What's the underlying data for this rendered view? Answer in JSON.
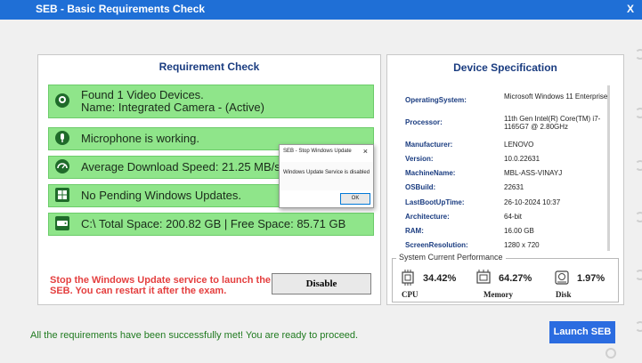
{
  "window": {
    "title": "SEB - Basic Requirements Check",
    "close_label": "X"
  },
  "requirement_check": {
    "title": "Requirement Check",
    "items": [
      {
        "icon": "camera-icon",
        "line1": "Found 1 Video Devices.",
        "line2": "Name:  Integrated Camera - (Active)"
      },
      {
        "icon": "microphone-icon",
        "line1": "Microphone is working."
      },
      {
        "icon": "speedometer-icon",
        "line1": "Average Download Speed: 21.25 MB/s"
      },
      {
        "icon": "windows-update-icon",
        "line1": "No Pending Windows Updates."
      },
      {
        "icon": "disk-icon",
        "line1": "C:\\ Total Space: 200.82 GB | Free Space: 85.71 GB"
      }
    ],
    "warning": "Stop the Windows Update service to launch the SEB. You can restart it after the exam.",
    "disable_label": "Disable"
  },
  "device_spec": {
    "title": "Device Specification",
    "rows": [
      {
        "key": "OperatingSystem:",
        "value": "Microsoft Windows 11 Enterprise"
      },
      {
        "key": "Processor:",
        "value": "11th Gen Intel(R) Core(TM) i7-1165G7 @ 2.80GHz"
      },
      {
        "key": "Manufacturer:",
        "value": "LENOVO"
      },
      {
        "key": "Version:",
        "value": "10.0.22631"
      },
      {
        "key": "MachineName:",
        "value": "MBL-ASS-VINAYJ"
      },
      {
        "key": "OSBuild:",
        "value": "22631"
      },
      {
        "key": "LastBootUpTime:",
        "value": "26-10-2024 10:37"
      },
      {
        "key": "Architecture:",
        "value": "64-bit"
      },
      {
        "key": "RAM:",
        "value": "16.00 GB"
      },
      {
        "key": "ScreenResolution:",
        "value": "1280 x 720"
      }
    ],
    "performance": {
      "legend": "System Current Performance",
      "cpu": {
        "value": "34.42%",
        "label": "CPU"
      },
      "memory": {
        "value": "64.27%",
        "label": "Memory"
      },
      "disk": {
        "value": "1.97%",
        "label": "Disk"
      }
    }
  },
  "dialog": {
    "title": "SEB - Stop Windows Update",
    "close_label": "×",
    "message": "Windows Update Service is disabled",
    "ok_label": "OK"
  },
  "status_message": "All the requirements have been successfully met! You are ready to proceed.",
  "launch_label": "Launch SEB",
  "colors": {
    "titlebar": "#1f6fd6",
    "item_bg": "#8fe58a",
    "warning": "#e43f3f",
    "success": "#1f7a1f",
    "launch": "#2b6ce0",
    "heading": "#1a3c80"
  }
}
